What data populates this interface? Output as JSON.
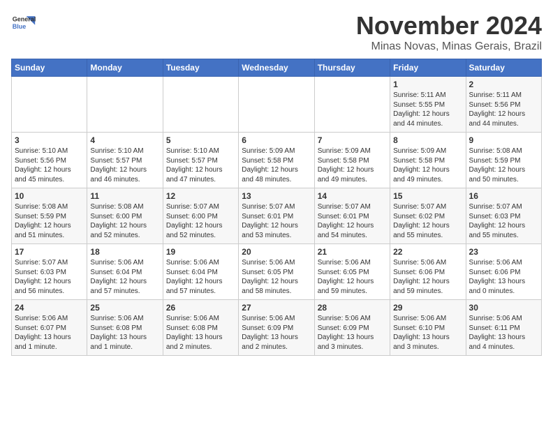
{
  "header": {
    "logo_line1": "General",
    "logo_line2": "Blue",
    "month": "November 2024",
    "location": "Minas Novas, Minas Gerais, Brazil"
  },
  "days_of_week": [
    "Sunday",
    "Monday",
    "Tuesday",
    "Wednesday",
    "Thursday",
    "Friday",
    "Saturday"
  ],
  "weeks": [
    [
      {
        "day": "",
        "info": ""
      },
      {
        "day": "",
        "info": ""
      },
      {
        "day": "",
        "info": ""
      },
      {
        "day": "",
        "info": ""
      },
      {
        "day": "",
        "info": ""
      },
      {
        "day": "1",
        "info": "Sunrise: 5:11 AM\nSunset: 5:55 PM\nDaylight: 12 hours\nand 44 minutes."
      },
      {
        "day": "2",
        "info": "Sunrise: 5:11 AM\nSunset: 5:56 PM\nDaylight: 12 hours\nand 44 minutes."
      }
    ],
    [
      {
        "day": "3",
        "info": "Sunrise: 5:10 AM\nSunset: 5:56 PM\nDaylight: 12 hours\nand 45 minutes."
      },
      {
        "day": "4",
        "info": "Sunrise: 5:10 AM\nSunset: 5:57 PM\nDaylight: 12 hours\nand 46 minutes."
      },
      {
        "day": "5",
        "info": "Sunrise: 5:10 AM\nSunset: 5:57 PM\nDaylight: 12 hours\nand 47 minutes."
      },
      {
        "day": "6",
        "info": "Sunrise: 5:09 AM\nSunset: 5:58 PM\nDaylight: 12 hours\nand 48 minutes."
      },
      {
        "day": "7",
        "info": "Sunrise: 5:09 AM\nSunset: 5:58 PM\nDaylight: 12 hours\nand 49 minutes."
      },
      {
        "day": "8",
        "info": "Sunrise: 5:09 AM\nSunset: 5:58 PM\nDaylight: 12 hours\nand 49 minutes."
      },
      {
        "day": "9",
        "info": "Sunrise: 5:08 AM\nSunset: 5:59 PM\nDaylight: 12 hours\nand 50 minutes."
      }
    ],
    [
      {
        "day": "10",
        "info": "Sunrise: 5:08 AM\nSunset: 5:59 PM\nDaylight: 12 hours\nand 51 minutes."
      },
      {
        "day": "11",
        "info": "Sunrise: 5:08 AM\nSunset: 6:00 PM\nDaylight: 12 hours\nand 52 minutes."
      },
      {
        "day": "12",
        "info": "Sunrise: 5:07 AM\nSunset: 6:00 PM\nDaylight: 12 hours\nand 52 minutes."
      },
      {
        "day": "13",
        "info": "Sunrise: 5:07 AM\nSunset: 6:01 PM\nDaylight: 12 hours\nand 53 minutes."
      },
      {
        "day": "14",
        "info": "Sunrise: 5:07 AM\nSunset: 6:01 PM\nDaylight: 12 hours\nand 54 minutes."
      },
      {
        "day": "15",
        "info": "Sunrise: 5:07 AM\nSunset: 6:02 PM\nDaylight: 12 hours\nand 55 minutes."
      },
      {
        "day": "16",
        "info": "Sunrise: 5:07 AM\nSunset: 6:03 PM\nDaylight: 12 hours\nand 55 minutes."
      }
    ],
    [
      {
        "day": "17",
        "info": "Sunrise: 5:07 AM\nSunset: 6:03 PM\nDaylight: 12 hours\nand 56 minutes."
      },
      {
        "day": "18",
        "info": "Sunrise: 5:06 AM\nSunset: 6:04 PM\nDaylight: 12 hours\nand 57 minutes."
      },
      {
        "day": "19",
        "info": "Sunrise: 5:06 AM\nSunset: 6:04 PM\nDaylight: 12 hours\nand 57 minutes."
      },
      {
        "day": "20",
        "info": "Sunrise: 5:06 AM\nSunset: 6:05 PM\nDaylight: 12 hours\nand 58 minutes."
      },
      {
        "day": "21",
        "info": "Sunrise: 5:06 AM\nSunset: 6:05 PM\nDaylight: 12 hours\nand 59 minutes."
      },
      {
        "day": "22",
        "info": "Sunrise: 5:06 AM\nSunset: 6:06 PM\nDaylight: 12 hours\nand 59 minutes."
      },
      {
        "day": "23",
        "info": "Sunrise: 5:06 AM\nSunset: 6:06 PM\nDaylight: 13 hours\nand 0 minutes."
      }
    ],
    [
      {
        "day": "24",
        "info": "Sunrise: 5:06 AM\nSunset: 6:07 PM\nDaylight: 13 hours\nand 1 minute."
      },
      {
        "day": "25",
        "info": "Sunrise: 5:06 AM\nSunset: 6:08 PM\nDaylight: 13 hours\nand 1 minute."
      },
      {
        "day": "26",
        "info": "Sunrise: 5:06 AM\nSunset: 6:08 PM\nDaylight: 13 hours\nand 2 minutes."
      },
      {
        "day": "27",
        "info": "Sunrise: 5:06 AM\nSunset: 6:09 PM\nDaylight: 13 hours\nand 2 minutes."
      },
      {
        "day": "28",
        "info": "Sunrise: 5:06 AM\nSunset: 6:09 PM\nDaylight: 13 hours\nand 3 minutes."
      },
      {
        "day": "29",
        "info": "Sunrise: 5:06 AM\nSunset: 6:10 PM\nDaylight: 13 hours\nand 3 minutes."
      },
      {
        "day": "30",
        "info": "Sunrise: 5:06 AM\nSunset: 6:11 PM\nDaylight: 13 hours\nand 4 minutes."
      }
    ]
  ]
}
